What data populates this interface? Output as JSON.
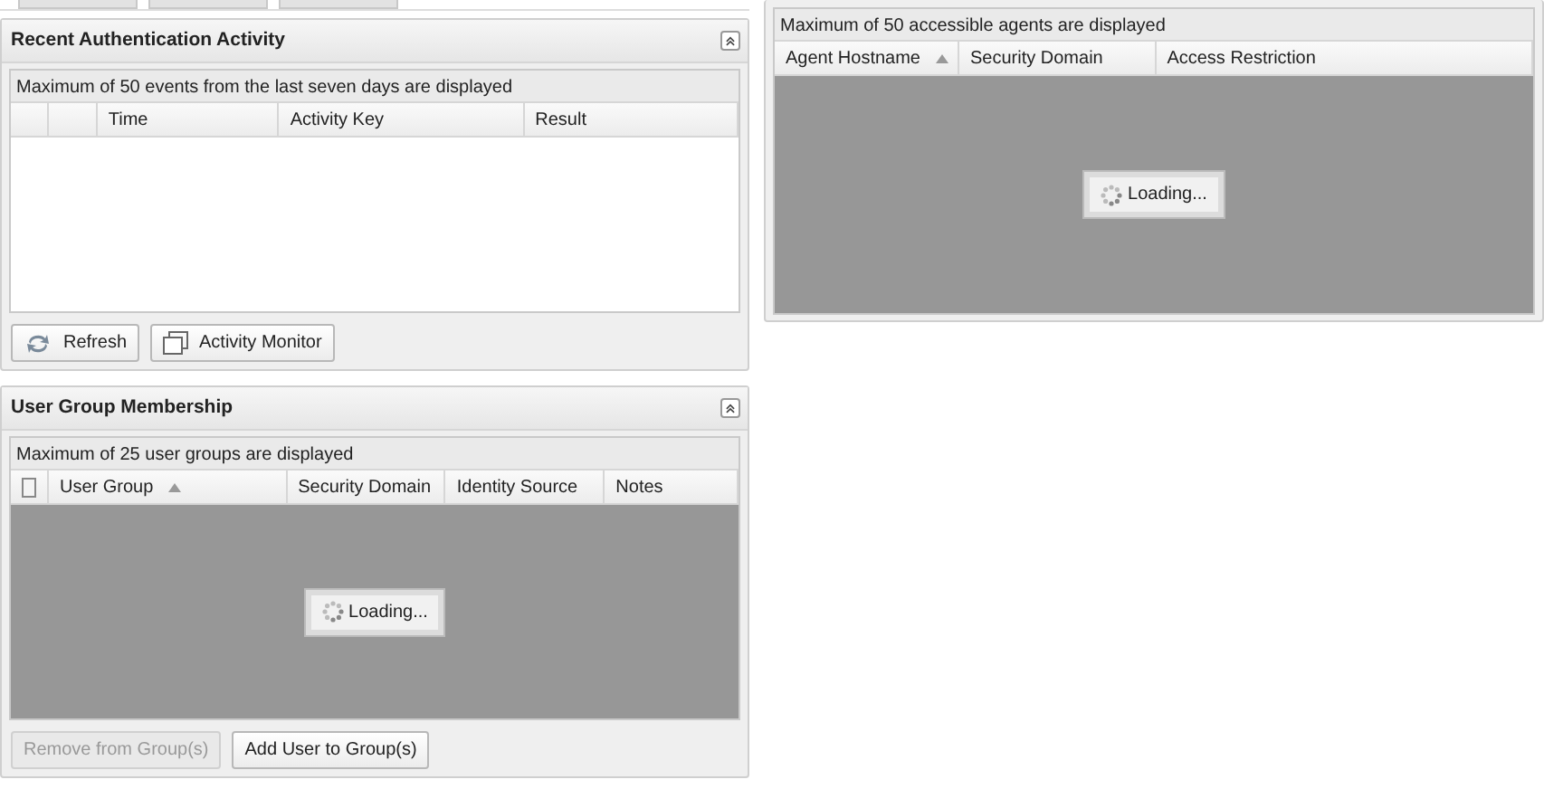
{
  "toolbar_buttons": [
    {
      "kind": "edge"
    },
    {
      "kind": "edge"
    },
    {
      "kind": "edge"
    }
  ],
  "recent_activity": {
    "title": "Recent Authentication Activity",
    "caption": "Maximum of 50 events from the last seven days are displayed",
    "columns": [
      {
        "kind": "blank"
      },
      {
        "kind": "blank"
      },
      {
        "kind": "text",
        "label": "Time",
        "sorted": false
      },
      {
        "kind": "text",
        "label": "Activity Key",
        "sorted": false
      },
      {
        "kind": "text",
        "label": "Result",
        "sorted": false
      }
    ],
    "buttons": [
      {
        "label": "Refresh",
        "kind": "refresh",
        "disabled": false
      },
      {
        "label": "Activity Monitor",
        "kind": "window",
        "disabled": false
      }
    ]
  },
  "user_groups": {
    "title": "User Group Membership",
    "caption": "Maximum of 25 user groups are displayed",
    "columns": [
      {
        "kind": "checkbox",
        "checked": false
      },
      {
        "kind": "text",
        "label": "User Group",
        "sorted": true
      },
      {
        "kind": "text",
        "label": "Security Domain",
        "sorted": false
      },
      {
        "kind": "text",
        "label": "Identity Source",
        "sorted": false
      },
      {
        "kind": "text",
        "label": "Notes",
        "sorted": false
      }
    ],
    "loading": "Loading...",
    "buttons": [
      {
        "label": "Remove from Group(s)",
        "disabled": true
      },
      {
        "label": "Add User to Group(s)",
        "disabled": false
      }
    ]
  },
  "agents": {
    "caption": "Maximum of 50 accessible agents are displayed",
    "columns": [
      {
        "kind": "text",
        "label": "Agent Hostname",
        "sorted": true
      },
      {
        "kind": "text",
        "label": "Security Domain",
        "sorted": false
      },
      {
        "kind": "text",
        "label": "Access Restriction",
        "sorted": false
      }
    ],
    "loading": "Loading..."
  }
}
